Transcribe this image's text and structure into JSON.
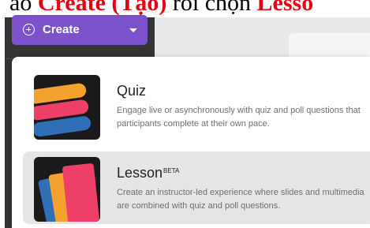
{
  "caption": {
    "prefix": "ào ",
    "create": "Create (Tạo)",
    "middle": " rồi chọn ",
    "lesson": "Lesso"
  },
  "create_button": {
    "label": "Create",
    "bg_color": "#7b52c9"
  },
  "menu": {
    "items": [
      {
        "title": "Quiz",
        "description": "Engage live or asynchronously with quiz and poll questions that participants complete at their own pace.",
        "icon": "quiz-icon"
      },
      {
        "title": "Lesson",
        "badge": "BETA",
        "description": "Create an instructor-led experience where slides and multimedia are combined with quiz and poll questions.",
        "icon": "lesson-icon"
      }
    ]
  },
  "colors": {
    "sidebar": "#343434",
    "accent_red": "#e60012",
    "stripe_orange": "#f4a22f",
    "stripe_pink": "#ee3f68",
    "stripe_blue": "#2f6fb5"
  }
}
